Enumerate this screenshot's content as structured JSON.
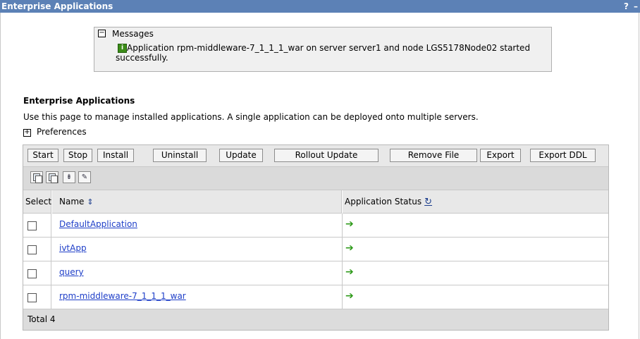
{
  "header": {
    "title": "Enterprise Applications",
    "help_label": "?",
    "minimize_label": "–"
  },
  "messages": {
    "toggle": "⊟",
    "title": "Messages",
    "info_icon": "i",
    "text": "Application rpm-middleware-7_1_1_1_war on server server1 and node LGS5178Node02 started successfully."
  },
  "section": {
    "heading": "Enterprise Applications",
    "description": "Use this page to manage installed applications. A single application can be deployed onto multiple servers."
  },
  "preferences": {
    "toggle": "⊞",
    "label": "Preferences"
  },
  "buttons": {
    "start": "Start",
    "stop": "Stop",
    "install": "Install",
    "uninstall": "Uninstall",
    "update": "Update",
    "rollout_update": "Rollout Update",
    "remove_file": "Remove File",
    "export": "Export",
    "export_ddl": "Export DDL"
  },
  "toolbar_icons": [
    "select-all-icon",
    "deselect-all-icon",
    "filter-show-icon",
    "filter-edit-icon"
  ],
  "table": {
    "columns": {
      "select": "Select",
      "name": "Name",
      "status": "Application Status"
    },
    "sort_icon": "⇕",
    "refresh_icon": "↻",
    "status_icon": "➔",
    "rows": [
      {
        "name": "DefaultApplication"
      },
      {
        "name": "ivtApp"
      },
      {
        "name": "query"
      },
      {
        "name": "rpm-middleware-7_1_1_1_war"
      }
    ],
    "total": "Total 4"
  },
  "colors": {
    "title_bar": "#5c81b6",
    "link": "#1e3ec8",
    "running": "#2e9a1a"
  }
}
